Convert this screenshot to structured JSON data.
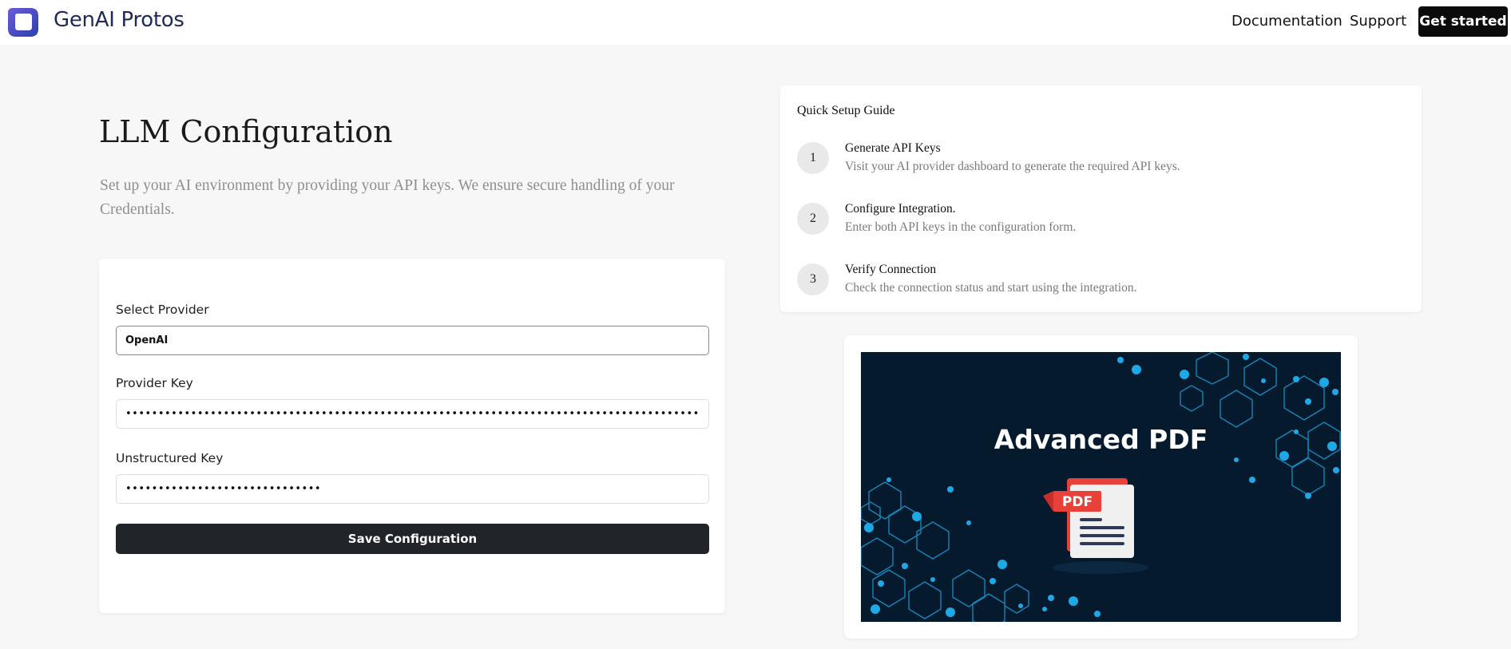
{
  "nav": {
    "brand": "GenAI Protos",
    "links": [
      "Documentation",
      "Support"
    ],
    "cta": "Get started"
  },
  "main": {
    "title": "LLM Configuration",
    "description": "Set up your AI environment by providing your API keys. We ensure secure handling of your Credentials."
  },
  "form": {
    "provider_label": "Select Provider",
    "provider_value": "OpenAI",
    "provider_key_label": "Provider Key",
    "provider_key_value": "•••••••••••••••••••••••••••••••••••••••••••••••••••••••••••••••••••••••••••••••••••••••••••••",
    "unstructured_key_label": "Unstructured Key",
    "unstructured_key_value": "••••••••••••••••••••••••••••••",
    "save_label": "Save Configuration"
  },
  "guide": {
    "title": "Quick Setup Guide",
    "steps": [
      {
        "num": "1",
        "title": "Generate API Keys",
        "desc": "Visit your AI provider dashboard to generate the required API keys."
      },
      {
        "num": "2",
        "title": "Configure Integration.",
        "desc": "Enter both API keys in the configuration form."
      },
      {
        "num": "3",
        "title": "Verify Connection",
        "desc": "Check the connection status and start using the integration."
      }
    ]
  },
  "banner": {
    "title": "Advanced PDF",
    "badge": "PDF"
  },
  "colors": {
    "primary_button": "#212529",
    "nav_cta": "#0b0b0b",
    "banner_bg": "#061a2e",
    "accent_blue": "#1fa8e6",
    "pdf_red": "#e8413a"
  }
}
